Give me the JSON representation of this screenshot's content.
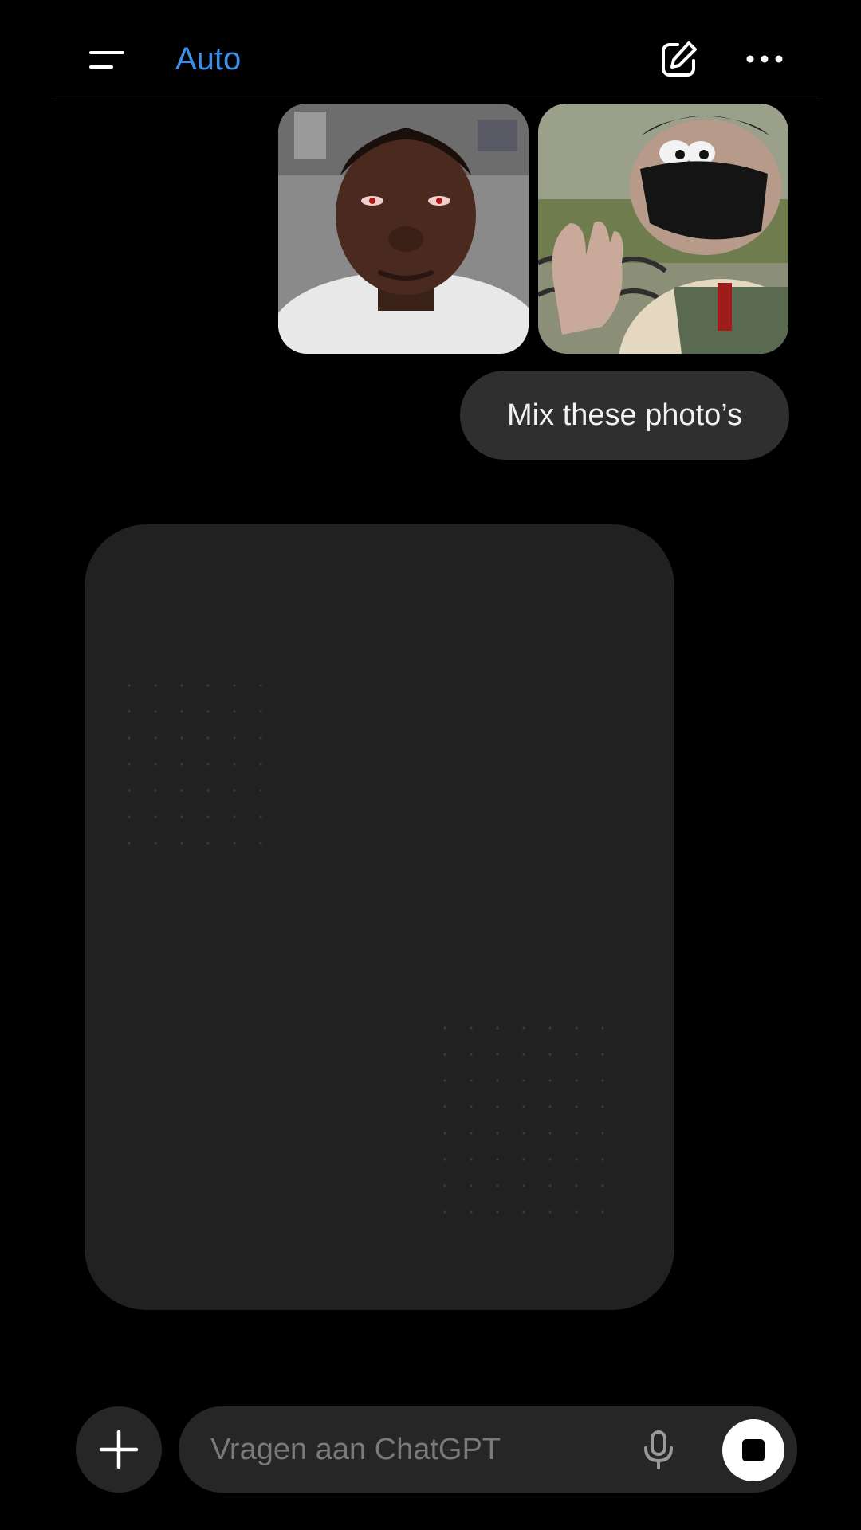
{
  "header": {
    "model_label": "Auto",
    "icons": {
      "menu": "menu-icon",
      "compose": "new-chat-icon",
      "more": "more-options-icon"
    }
  },
  "conversation": {
    "attachments": [
      {
        "description_icon": "photo-attachment-1"
      },
      {
        "description_icon": "photo-attachment-2"
      }
    ],
    "user_message": "Mix these photo’s",
    "assistant_image_state": "generating"
  },
  "composer": {
    "placeholder": "Vragen aan ChatGPT",
    "value": ""
  },
  "colors": {
    "background": "#000000",
    "accent": "#3b8fe8",
    "bubble": "#2f2f2f",
    "card": "#212121",
    "composer": "#262626"
  }
}
